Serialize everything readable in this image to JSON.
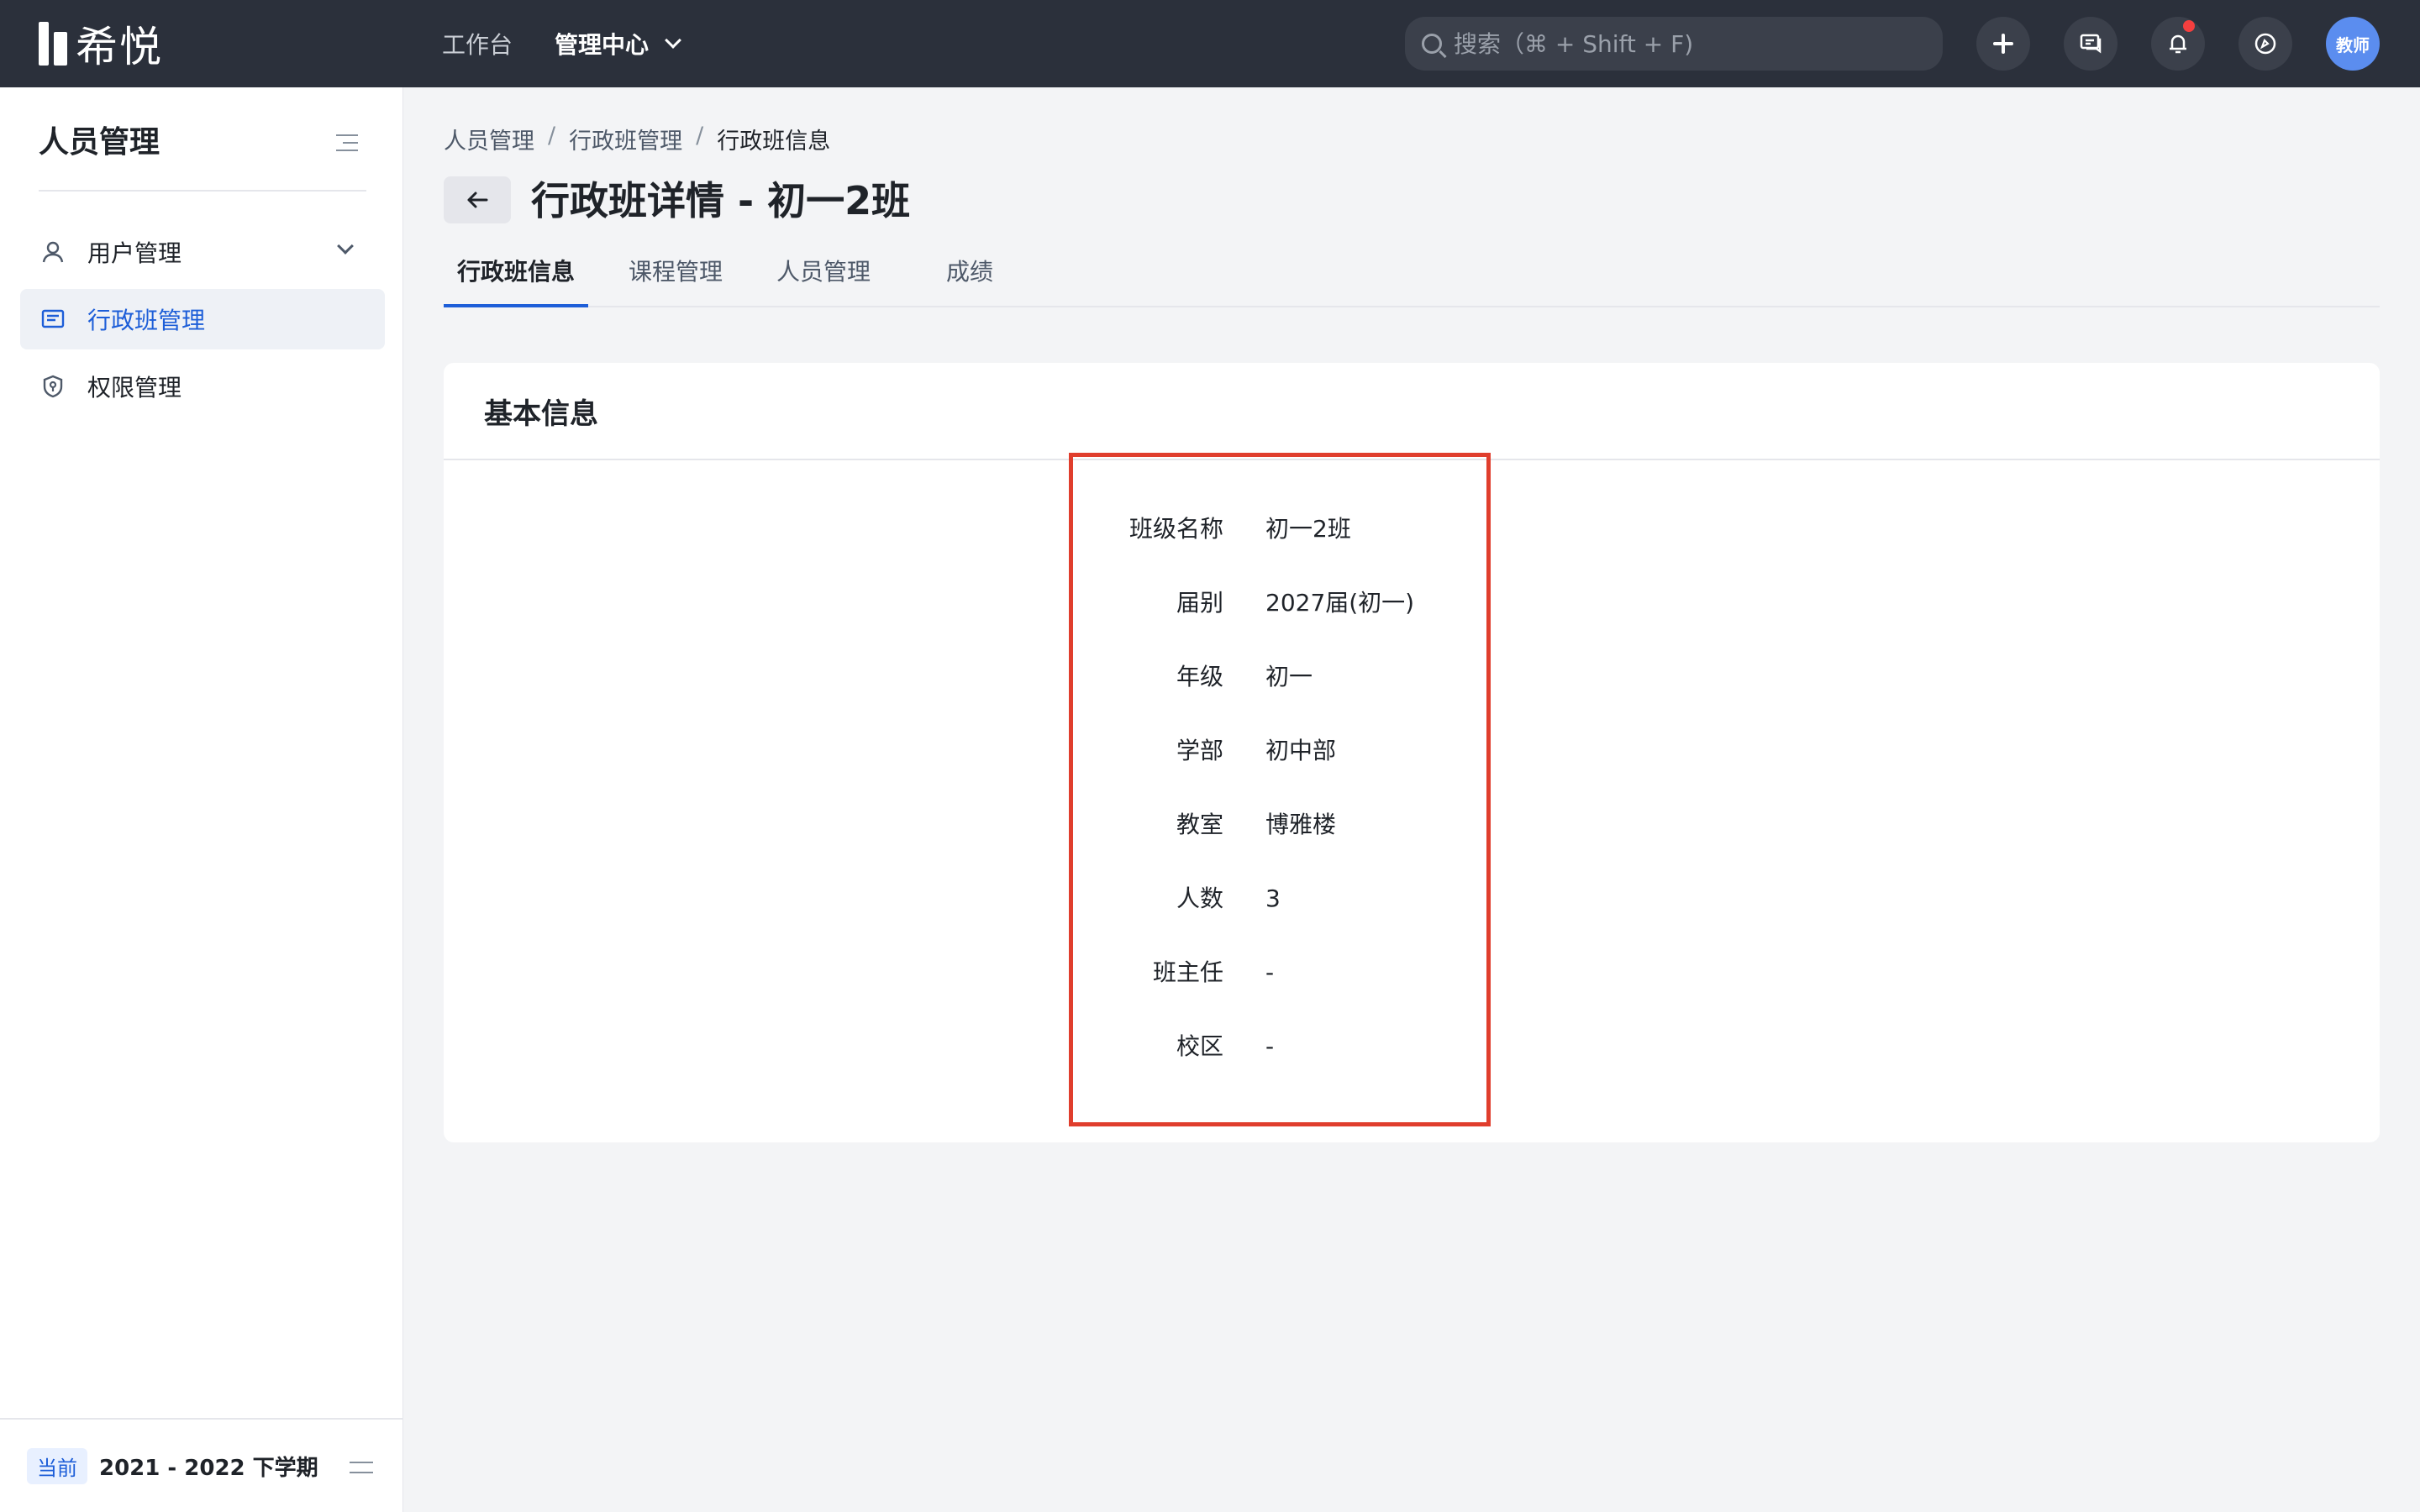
{
  "app": {
    "logo_text": "希悦"
  },
  "topbar": {
    "nav": [
      {
        "label": "工作台"
      },
      {
        "label": "管理中心"
      }
    ],
    "search": {
      "placeholder": "搜索（⌘ + Shift + F)"
    },
    "avatar_text": "教师"
  },
  "sidebar": {
    "title": "人员管理",
    "items": [
      {
        "label": "用户管理"
      },
      {
        "label": "行政班管理"
      },
      {
        "label": "权限管理"
      }
    ],
    "footer": {
      "badge": "当前",
      "term": "2021 - 2022 下学期"
    }
  },
  "breadcrumb": {
    "items": [
      "人员管理",
      "行政班管理",
      "行政班信息"
    ],
    "separator": "/"
  },
  "page": {
    "title": "行政班详情 - 初一2班"
  },
  "tabs": [
    {
      "label": "行政班信息"
    },
    {
      "label": "课程管理"
    },
    {
      "label": "人员管理"
    },
    {
      "label": "成绩"
    }
  ],
  "card": {
    "title": "基本信息",
    "fields": [
      {
        "label": "班级名称",
        "value": "初一2班"
      },
      {
        "label": "届别",
        "value": "2027届(初一)"
      },
      {
        "label": "年级",
        "value": "初一"
      },
      {
        "label": "学部",
        "value": "初中部"
      },
      {
        "label": "教室",
        "value": "博雅楼"
      },
      {
        "label": "人数",
        "value": "3"
      },
      {
        "label": "班主任",
        "value": "-"
      },
      {
        "label": "校区",
        "value": "-"
      }
    ]
  },
  "colors": {
    "topbar_bg": "#2b303b",
    "accent": "#1d5ed8",
    "highlight_border": "#e03e2d",
    "notification_dot": "#f53f3f",
    "avatar_bg": "#5b8def"
  }
}
